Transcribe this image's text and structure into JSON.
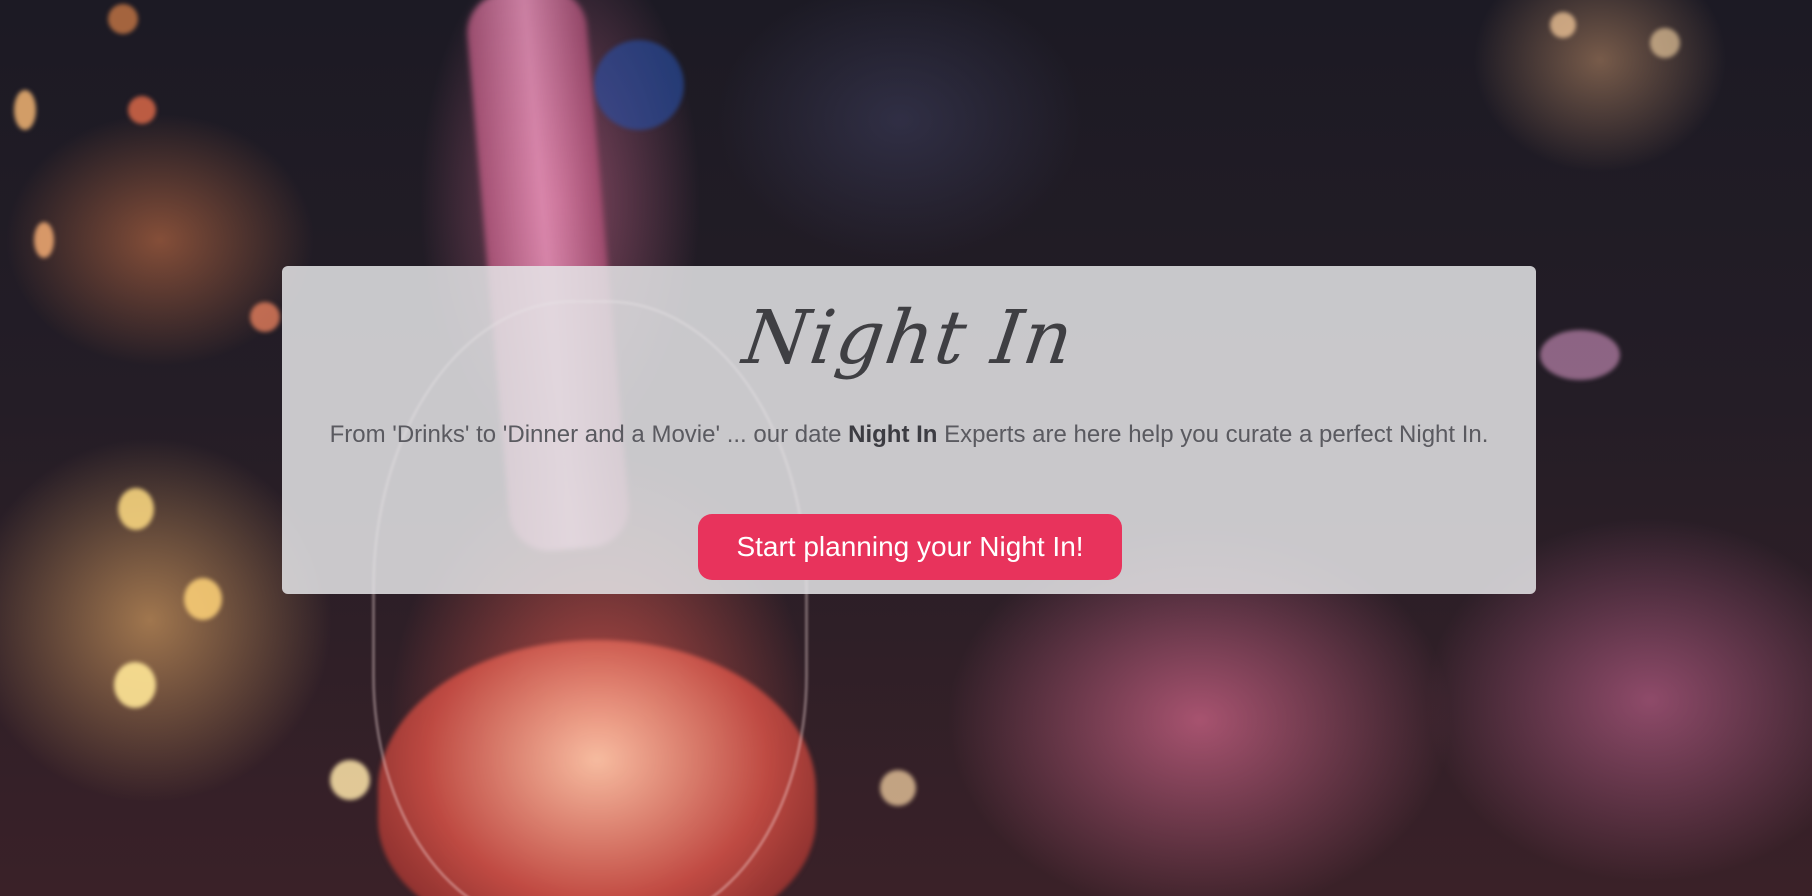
{
  "hero": {
    "title": "Night In",
    "tagline_before": "From 'Drinks' to 'Dinner and a Movie' ... our date ",
    "tagline_emphasis": "Night In",
    "tagline_after": " Experts are here help you curate a perfect Night In.",
    "cta_label": "Start planning your Night In!"
  },
  "colors": {
    "card_background": "#e4e4e6",
    "button": "#e8335c",
    "text": "#5a5a60"
  }
}
